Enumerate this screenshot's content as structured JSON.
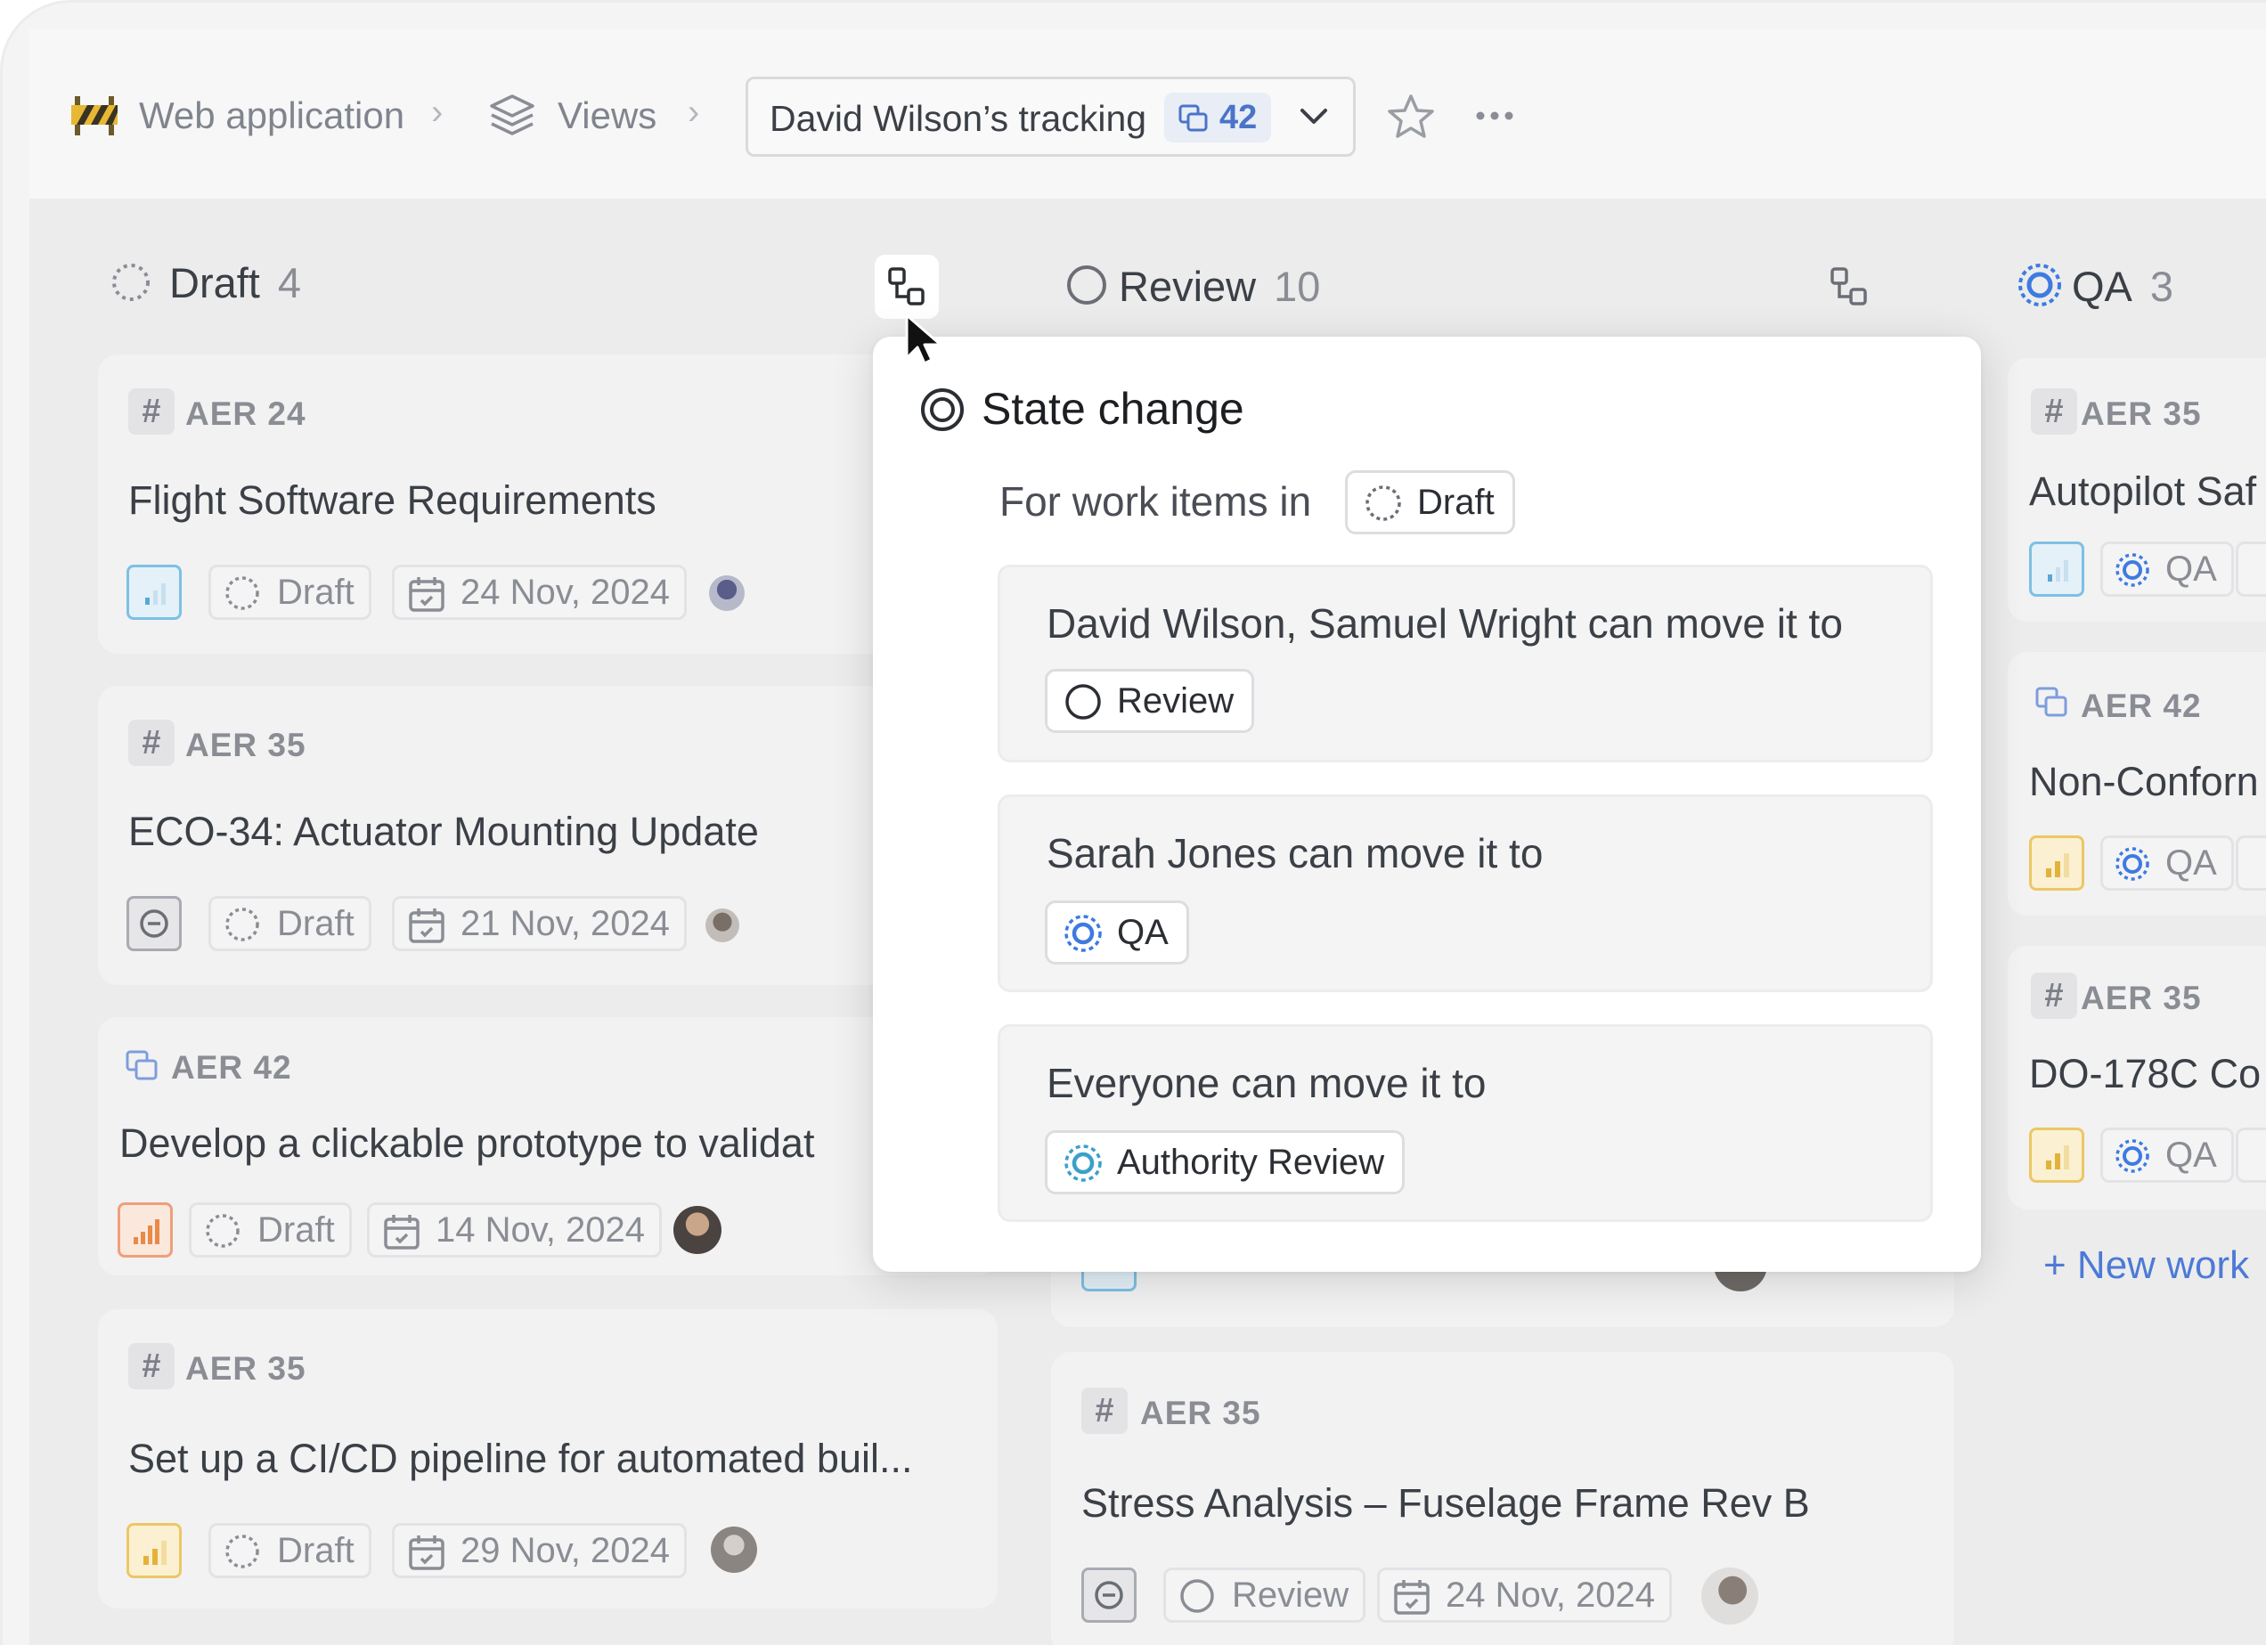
{
  "breadcrumb": {
    "project": "Web application",
    "section": "Views",
    "view_name": "David Wilson’s tracking",
    "view_count": "42"
  },
  "columns": [
    {
      "name": "Draft",
      "count": "4",
      "cards": [
        {
          "id": "AER 24",
          "title": "Flight Software Requirements",
          "state": "Draft",
          "date": "24 Nov, 2024"
        },
        {
          "id": "AER 35",
          "title": "ECO-34: Actuator Mounting Update",
          "state": "Draft",
          "date": "21 Nov, 2024"
        },
        {
          "id": "AER 42",
          "title": "Develop a clickable prototype to validat",
          "state": "Draft",
          "date": "14 Nov, 2024"
        },
        {
          "id": "AER 35",
          "title": "Set up a CI/CD pipeline for automated buil...",
          "state": "Draft",
          "date": "29 Nov, 2024"
        }
      ]
    },
    {
      "name": "Review",
      "count": "10",
      "cards": [
        {
          "id": "AER 35",
          "title": "Stress Analysis – Fuselage Frame Rev B",
          "state": "Review",
          "date": "24 Nov, 2024"
        }
      ]
    },
    {
      "name": "QA",
      "count": "3",
      "cards": [
        {
          "id": "AER 35",
          "title": "Autopilot Saf",
          "state": "QA"
        },
        {
          "id": "AER 42",
          "title": "Non-Conforn",
          "state": "QA"
        },
        {
          "id": "AER 35",
          "title": "DO-178C Co",
          "state": "QA"
        }
      ],
      "new_work": "+ New work"
    }
  ],
  "popover": {
    "title": "State change",
    "subtitle": "For work items in",
    "from_state": "Draft",
    "rules": [
      {
        "text": "David Wilson, Samuel Wright can move it to",
        "target": "Review"
      },
      {
        "text": "Sarah Jones can move it to",
        "target": "QA"
      },
      {
        "text": "Everyone can move it to",
        "target": "Authority Review"
      }
    ]
  },
  "colors": {
    "accent": "#4a74c8",
    "qa_blue": "#3d7be0",
    "priority_high": "#e98a4a",
    "priority_medium": "#e3b23a",
    "priority_low": "#5aa7d6"
  }
}
